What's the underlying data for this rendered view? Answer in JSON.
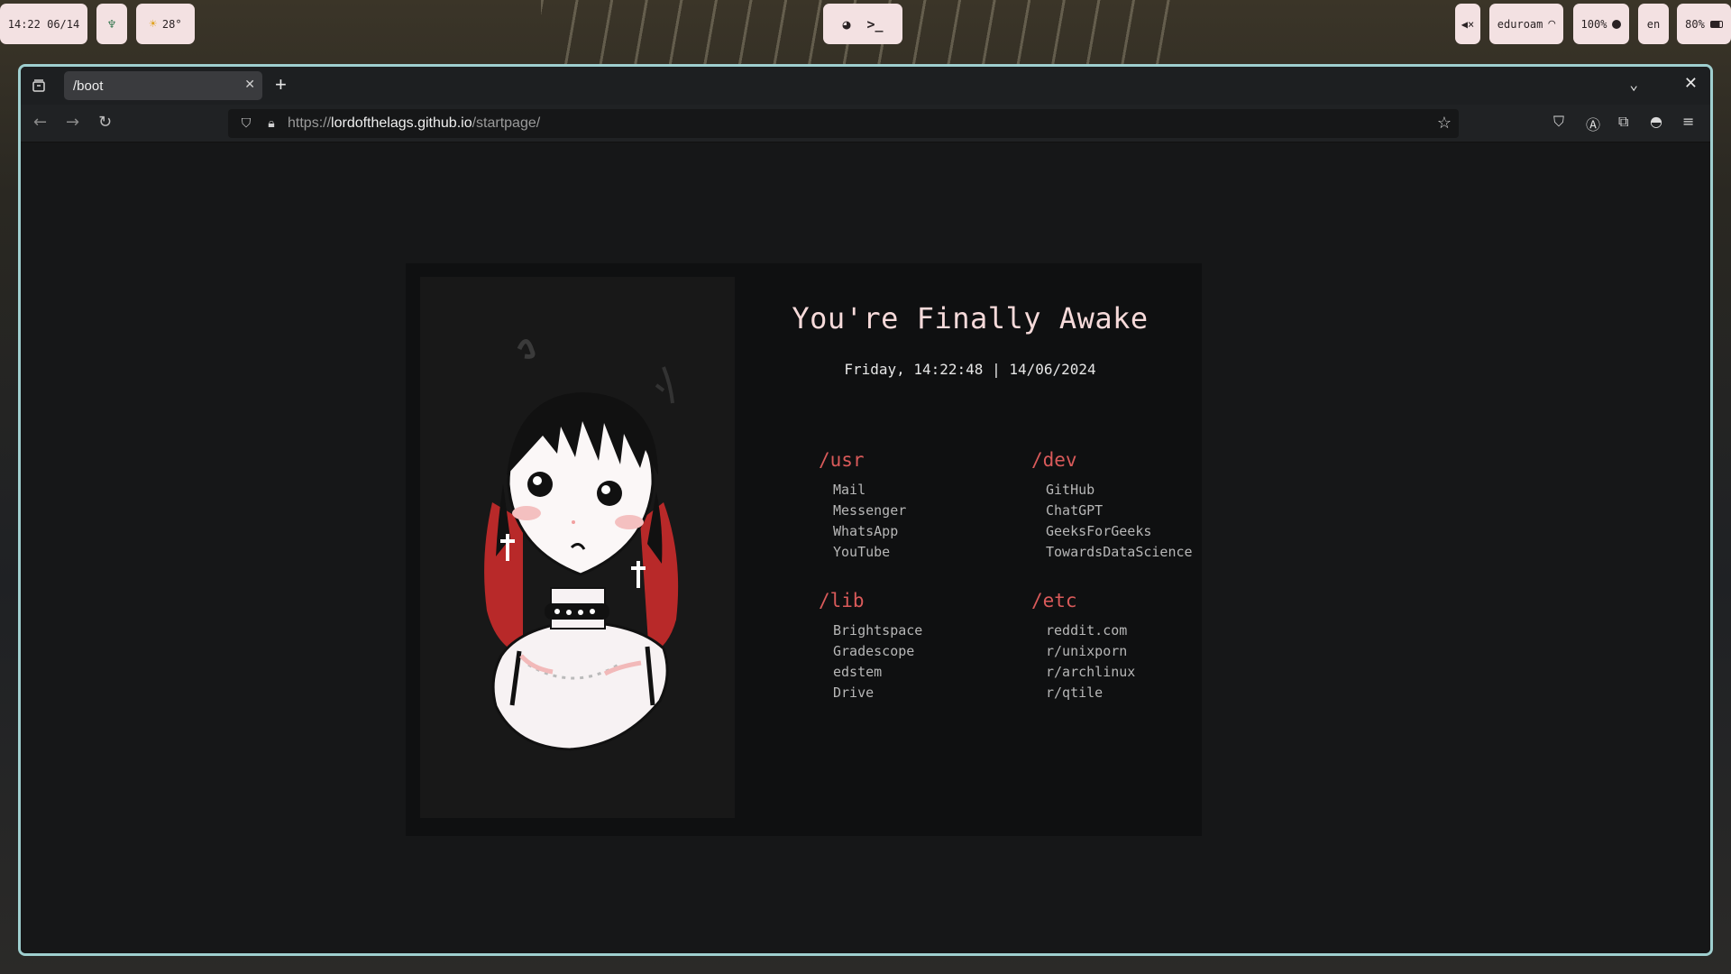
{
  "topbar": {
    "clock": "14:22 06/14",
    "weather": "28°",
    "volume_icon": "mute-speaker-icon",
    "network": "eduroam",
    "brightness": "100%",
    "keyboard_layout": "en",
    "battery": "80%"
  },
  "browser": {
    "tab_title": "/boot",
    "url_scheme": "https://",
    "url_host": "lordofthelags.github.io",
    "url_path": "/startpage/"
  },
  "startpage": {
    "title": "You're Finally Awake",
    "datetime": "Friday, 14:22:48 | 14/06/2024",
    "groups": [
      {
        "title": "/usr",
        "links": [
          "Mail",
          "Messenger",
          "WhatsApp",
          "YouTube"
        ]
      },
      {
        "title": "/dev",
        "links": [
          "GitHub",
          "ChatGPT",
          "GeeksForGeeks",
          "TowardsDataScience"
        ]
      },
      {
        "title": "/lib",
        "links": [
          "Brightspace",
          "Gradescope",
          "edstem",
          "Drive"
        ]
      },
      {
        "title": "/etc",
        "links": [
          "reddit.com",
          "r/unixporn",
          "r/archlinux",
          "r/qtile"
        ]
      }
    ]
  },
  "colors": {
    "accent_red": "#d95a5a",
    "title_pink": "#f6dada",
    "pill_bg": "#f3e1e2",
    "window_border": "#9fcfcf"
  }
}
